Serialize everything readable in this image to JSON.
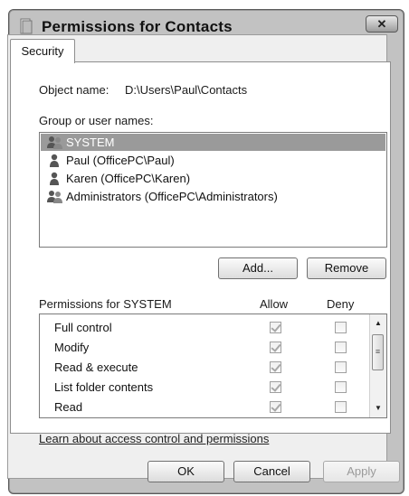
{
  "window": {
    "title": "Permissions for Contacts",
    "close_label": "✕"
  },
  "tabs": [
    {
      "label": "Security",
      "selected": true
    }
  ],
  "object": {
    "label": "Object name:",
    "value": "D:\\Users\\Paul\\Contacts"
  },
  "groups": {
    "label": "Group or user names:",
    "items": [
      {
        "name": "SYSTEM",
        "icon": "users-group-icon",
        "selected": true
      },
      {
        "name": "Paul (OfficePC\\Paul)",
        "icon": "user-icon",
        "selected": false
      },
      {
        "name": "Karen (OfficePC\\Karen)",
        "icon": "user-icon",
        "selected": false
      },
      {
        "name": "Administrators (OfficePC\\Administrators)",
        "icon": "users-group-icon",
        "selected": false
      }
    ]
  },
  "buttons": {
    "add": "Add...",
    "remove": "Remove",
    "ok": "OK",
    "cancel": "Cancel",
    "apply": "Apply"
  },
  "permissions": {
    "label": "Permissions for SYSTEM",
    "allow_header": "Allow",
    "deny_header": "Deny",
    "rows": [
      {
        "name": "Full control",
        "allow": true,
        "deny": false
      },
      {
        "name": "Modify",
        "allow": true,
        "deny": false
      },
      {
        "name": "Read & execute",
        "allow": true,
        "deny": false
      },
      {
        "name": "List folder contents",
        "allow": true,
        "deny": false
      },
      {
        "name": "Read",
        "allow": true,
        "deny": false
      }
    ]
  },
  "link": "Learn about access control and permissions",
  "colors": {
    "selected_row": "#9a9a9a",
    "panel_bg": "#ffffff",
    "chrome_bg": "#c2c2c2"
  }
}
